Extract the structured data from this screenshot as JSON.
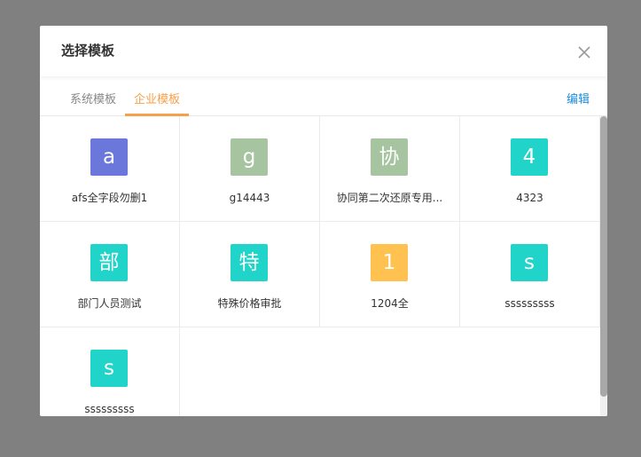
{
  "dialog": {
    "title": "选择模板",
    "close_icon": "close-icon"
  },
  "tabs": [
    {
      "label": "系统模板",
      "active": false
    },
    {
      "label": "企业模板",
      "active": true
    }
  ],
  "edit_label": "编辑",
  "colors": {
    "accent": "#f5a04a",
    "link": "#1a8cdc"
  },
  "templates": [
    {
      "icon_char": "a",
      "name": "afs全字段勿删1",
      "color": "#6b77db"
    },
    {
      "icon_char": "g",
      "name": "g14443",
      "color": "#a7c4a0"
    },
    {
      "icon_char": "协",
      "name": "协同第二次还原专用...",
      "color": "#a7c4a0"
    },
    {
      "icon_char": "4",
      "name": "4323",
      "color": "#21d4c9"
    },
    {
      "icon_char": "部",
      "name": "部门人员测试",
      "color": "#21d4c9"
    },
    {
      "icon_char": "特",
      "name": "特殊价格审批",
      "color": "#21d4c9"
    },
    {
      "icon_char": "1",
      "name": "1204全",
      "color": "#ffc14f"
    },
    {
      "icon_char": "s",
      "name": "sssssssss",
      "color": "#21d4c9"
    },
    {
      "icon_char": "s",
      "name": "sssssssss",
      "color": "#21d4c9"
    }
  ]
}
